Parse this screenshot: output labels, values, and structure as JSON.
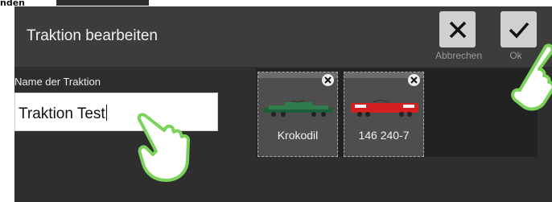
{
  "top_fragment": "nden",
  "dialog": {
    "title": "Traktion bearbeiten",
    "cancel_label": "Abbrechen",
    "ok_label": "Ok"
  },
  "form": {
    "name_label": "Name der Traktion",
    "name_value": "Traktion Test"
  },
  "locos": [
    {
      "name": "Krokodil",
      "color": "#2e8b57"
    },
    {
      "name": "146 240-7",
      "color": "#d42020"
    }
  ],
  "colors": {
    "dialog_bg": "#2e2e2e",
    "header_bg": "#3c3c3c",
    "pointer_hand": "#7ad35a"
  },
  "icons": [
    "close-icon",
    "check-icon",
    "delete-icon",
    "pointer-hand-icon"
  ]
}
